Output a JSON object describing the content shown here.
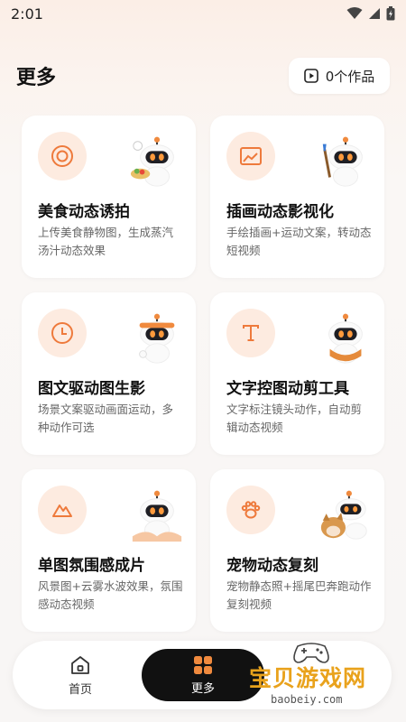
{
  "status_bar": {
    "time": "2:01"
  },
  "header": {
    "title": "更多",
    "works_button_label": "0个作品"
  },
  "cards": [
    {
      "title": "美食动态诱拍",
      "desc": "上传美食静物图，生成蒸汽汤汁动态效果",
      "icon": "circle-target-icon"
    },
    {
      "title": "插画动态影视化",
      "desc": "手绘插画+运动文案，转动态短视频",
      "icon": "picture-icon"
    },
    {
      "title": "图文驱动图生影",
      "desc": "场景文案驱动画面运动，多种动作可选",
      "icon": "clock-icon"
    },
    {
      "title": "文字控图动剪工具",
      "desc": "文字标注镜头动作，自动剪辑动态视频",
      "icon": "text-t-icon"
    },
    {
      "title": "单图氛围感成片",
      "desc": "风景图+云雾水波效果，氛围感动态视频",
      "icon": "mountain-icon"
    },
    {
      "title": "宠物动态复刻",
      "desc": "宠物静态照+摇尾巴奔跑动作复刻视频",
      "icon": "paw-icon"
    }
  ],
  "bottom_nav": {
    "home_label": "首页",
    "more_label": "更多"
  },
  "watermark": {
    "text": "宝贝游戏网",
    "url": "baobeiy.com"
  },
  "colors": {
    "accent": "#ee7a3c",
    "icon_bg": "#fdebe0",
    "nav_active_bg": "#111111"
  }
}
